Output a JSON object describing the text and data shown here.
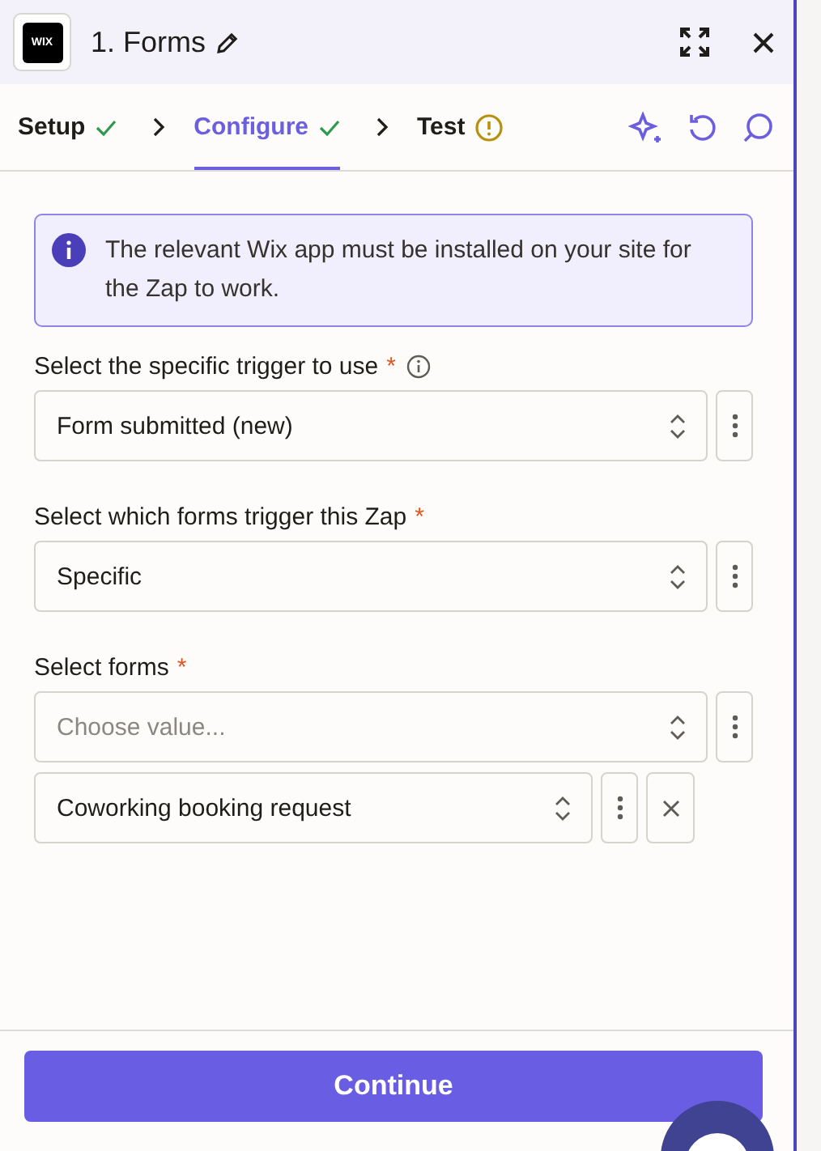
{
  "header": {
    "logo": "WIX",
    "title": "1. Forms"
  },
  "steps": [
    {
      "label": "Setup",
      "kind": "done",
      "selected": false
    },
    {
      "label": "Configure",
      "kind": "done",
      "selected": true
    },
    {
      "label": "Test",
      "kind": "warning",
      "selected": false
    }
  ],
  "notice": "The relevant Wix app must be installed on your site for the Zap to work.",
  "fields": [
    {
      "label": "Select the specific trigger to use",
      "asterisk": "*",
      "info": true,
      "inputs": [
        {
          "value": "Form submitted (new)",
          "removable": false
        }
      ]
    },
    {
      "label": "Select which forms trigger this Zap",
      "asterisk": "*",
      "info": false,
      "inputs": [
        {
          "value": "Specific",
          "removable": false
        }
      ]
    },
    {
      "label": "Select forms",
      "asterisk": "*",
      "info": false,
      "inputs": [
        {
          "placeholder": "Choose value...",
          "removable": false
        },
        {
          "value": "Coworking booking request",
          "removable": true
        }
      ]
    }
  ],
  "continue_button": "Continue"
}
